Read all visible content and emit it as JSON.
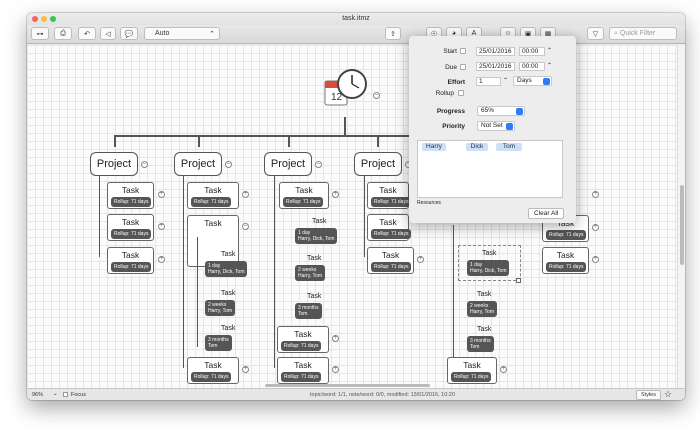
{
  "window": {
    "title": "task.itmz"
  },
  "toolbar": {
    "zoom_select": "Auto",
    "search_placeholder": "Quick Filter"
  },
  "map": {
    "projects": [
      "Project",
      "Project",
      "Project",
      "Project"
    ],
    "task_label": "Task",
    "rollup": "Rollup: 71 days",
    "sub_tasks": {
      "harry_dick_tom": "1 day\nHarry, Dick, Tom",
      "harry_tom_2w": "2 weeks\nHarry, Tom",
      "tom_3m": "3 months\nTom"
    }
  },
  "popover": {
    "start_label": "Start",
    "start_date": "25/01/2016",
    "start_time": "00:00",
    "due_label": "Due",
    "due_date": "25/01/2016",
    "due_time": "00:00",
    "effort_label": "Effort",
    "effort_value": "1",
    "effort_unit": "Days",
    "rollup_label": "Rollup",
    "progress_label": "Progress",
    "progress_value": "65%",
    "priority_label": "Priority",
    "priority_value": "Not Set",
    "resources": [
      "Harry",
      "Dick",
      "Tom"
    ],
    "resources_label": "Resources",
    "clear_all": "Clear All"
  },
  "statusbar": {
    "zoom": "96%",
    "focus": "Focus",
    "info": "topic/word: 1/1, note/word: 0/0, modified: 13/01/2016, 10:20",
    "styles": "Styles"
  },
  "colors": {
    "accent": "#2f7cf6",
    "tag_bg": "#555555",
    "resource_pill": "#cde0f7"
  }
}
